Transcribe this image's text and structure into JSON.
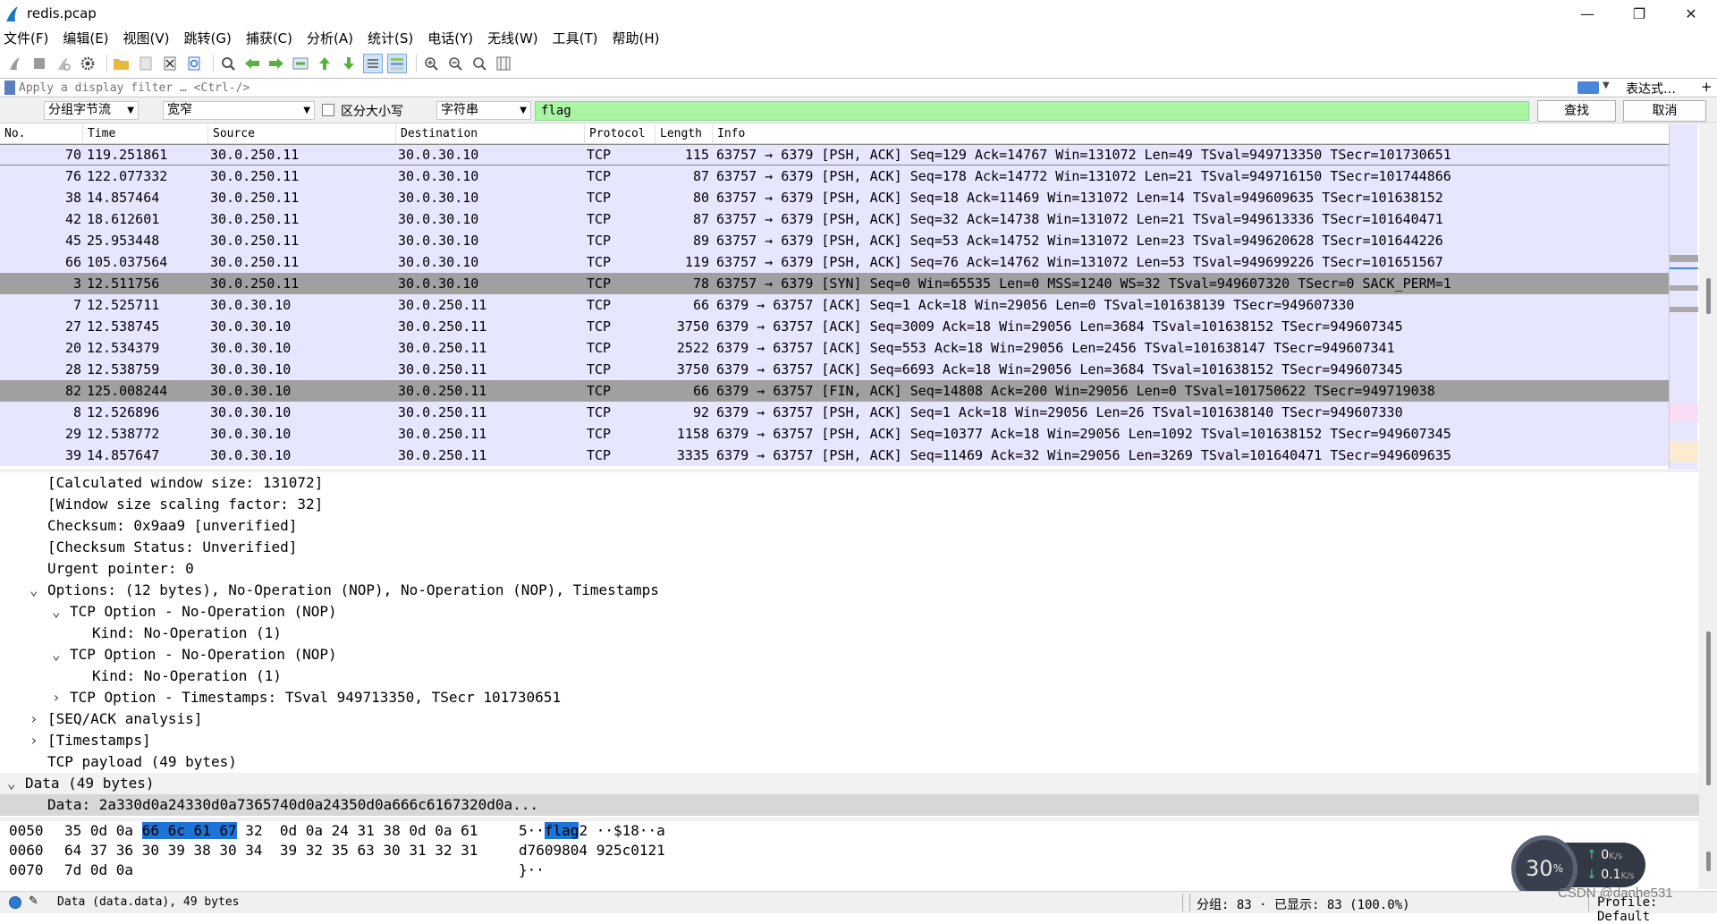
{
  "window": {
    "title": "redis.pcap",
    "minimize": "—",
    "maximize": "❐",
    "close": "✕"
  },
  "menu": [
    "文件(F)",
    "编辑(E)",
    "视图(V)",
    "跳转(G)",
    "捕获(C)",
    "分析(A)",
    "统计(S)",
    "电话(Y)",
    "无线(W)",
    "工具(T)",
    "帮助(H)"
  ],
  "filter": {
    "placeholder": "Apply a display filter … <Ctrl-/>",
    "expression_label": "表达式…",
    "plus": "+"
  },
  "find": {
    "scope": "分组字节流",
    "charset": "宽窄",
    "case_label": "区分大小写",
    "type": "字符串",
    "value": "flag",
    "find_label": "查找",
    "cancel_label": "取消"
  },
  "columns": [
    "No.",
    "Time",
    "Source",
    "Destination",
    "Protocol",
    "Length",
    "Info"
  ],
  "packets": [
    {
      "no": "70",
      "time": "119.251861",
      "src": "30.0.250.11",
      "dst": "30.0.30.10",
      "proto": "TCP",
      "len": "115",
      "info": "63757 → 6379 [PSH, ACK] Seq=129 Ack=14767 Win=131072 Len=49 TSval=949713350 TSecr=101730651",
      "style": "first"
    },
    {
      "no": "76",
      "time": "122.077332",
      "src": "30.0.250.11",
      "dst": "30.0.30.10",
      "proto": "TCP",
      "len": "87",
      "info": "63757 → 6379 [PSH, ACK] Seq=178 Ack=14772 Win=131072 Len=21 TSval=949716150 TSecr=101744866",
      "style": ""
    },
    {
      "no": "38",
      "time": "14.857464",
      "src": "30.0.250.11",
      "dst": "30.0.30.10",
      "proto": "TCP",
      "len": "80",
      "info": "63757 → 6379 [PSH, ACK] Seq=18 Ack=11469 Win=131072 Len=14 TSval=949609635 TSecr=101638152",
      "style": ""
    },
    {
      "no": "42",
      "time": "18.612601",
      "src": "30.0.250.11",
      "dst": "30.0.30.10",
      "proto": "TCP",
      "len": "87",
      "info": "63757 → 6379 [PSH, ACK] Seq=32 Ack=14738 Win=131072 Len=21 TSval=949613336 TSecr=101640471",
      "style": ""
    },
    {
      "no": "45",
      "time": "25.953448",
      "src": "30.0.250.11",
      "dst": "30.0.30.10",
      "proto": "TCP",
      "len": "89",
      "info": "63757 → 6379 [PSH, ACK] Seq=53 Ack=14752 Win=131072 Len=23 TSval=949620628 TSecr=101644226",
      "style": ""
    },
    {
      "no": "66",
      "time": "105.037564",
      "src": "30.0.250.11",
      "dst": "30.0.30.10",
      "proto": "TCP",
      "len": "119",
      "info": "63757 → 6379 [PSH, ACK] Seq=76 Ack=14762 Win=131072 Len=53 TSval=949699226 TSecr=101651567",
      "style": ""
    },
    {
      "no": "3",
      "time": "12.511756",
      "src": "30.0.250.11",
      "dst": "30.0.30.10",
      "proto": "TCP",
      "len": "78",
      "info": "63757 → 6379 [SYN] Seq=0 Win=65535 Len=0 MSS=1240 WS=32 TSval=949607320 TSecr=0 SACK_PERM=1",
      "style": "gray"
    },
    {
      "no": "7",
      "time": "12.525711",
      "src": "30.0.30.10",
      "dst": "30.0.250.11",
      "proto": "TCP",
      "len": "66",
      "info": "6379 → 63757 [ACK] Seq=1 Ack=18 Win=29056 Len=0 TSval=101638139 TSecr=949607330",
      "style": ""
    },
    {
      "no": "27",
      "time": "12.538745",
      "src": "30.0.30.10",
      "dst": "30.0.250.11",
      "proto": "TCP",
      "len": "3750",
      "info": "6379 → 63757 [ACK] Seq=3009 Ack=18 Win=29056 Len=3684 TSval=101638152 TSecr=949607345",
      "style": ""
    },
    {
      "no": "20",
      "time": "12.534379",
      "src": "30.0.30.10",
      "dst": "30.0.250.11",
      "proto": "TCP",
      "len": "2522",
      "info": "6379 → 63757 [ACK] Seq=553 Ack=18 Win=29056 Len=2456 TSval=101638147 TSecr=949607341",
      "style": ""
    },
    {
      "no": "28",
      "time": "12.538759",
      "src": "30.0.30.10",
      "dst": "30.0.250.11",
      "proto": "TCP",
      "len": "3750",
      "info": "6379 → 63757 [ACK] Seq=6693 Ack=18 Win=29056 Len=3684 TSval=101638152 TSecr=949607345",
      "style": ""
    },
    {
      "no": "82",
      "time": "125.008244",
      "src": "30.0.30.10",
      "dst": "30.0.250.11",
      "proto": "TCP",
      "len": "66",
      "info": "6379 → 63757 [FIN, ACK] Seq=14808 Ack=200 Win=29056 Len=0 TSval=101750622 TSecr=949719038",
      "style": "gray"
    },
    {
      "no": "8",
      "time": "12.526896",
      "src": "30.0.30.10",
      "dst": "30.0.250.11",
      "proto": "TCP",
      "len": "92",
      "info": "6379 → 63757 [PSH, ACK] Seq=1 Ack=18 Win=29056 Len=26 TSval=101638140 TSecr=949607330",
      "style": ""
    },
    {
      "no": "29",
      "time": "12.538772",
      "src": "30.0.30.10",
      "dst": "30.0.250.11",
      "proto": "TCP",
      "len": "1158",
      "info": "6379 → 63757 [PSH, ACK] Seq=10377 Ack=18 Win=29056 Len=1092 TSval=101638152 TSecr=949607345",
      "style": ""
    },
    {
      "no": "39",
      "time": "14.857647",
      "src": "30.0.30.10",
      "dst": "30.0.250.11",
      "proto": "TCP",
      "len": "3335",
      "info": "6379 → 63757 [PSH, ACK] Seq=11469 Ack=32 Win=29056 Len=3269 TSval=101640471 TSecr=949609635",
      "style": ""
    }
  ],
  "details": [
    {
      "indent": 2,
      "twisty": "",
      "text": "[Calculated window size: 131072]",
      "style": ""
    },
    {
      "indent": 2,
      "twisty": "",
      "text": "[Window size scaling factor: 32]",
      "style": ""
    },
    {
      "indent": 2,
      "twisty": "",
      "text": "Checksum: 0x9aa9 [unverified]",
      "style": ""
    },
    {
      "indent": 2,
      "twisty": "",
      "text": "[Checksum Status: Unverified]",
      "style": ""
    },
    {
      "indent": 2,
      "twisty": "",
      "text": "Urgent pointer: 0",
      "style": ""
    },
    {
      "indent": 2,
      "twisty": "v",
      "text": "Options: (12 bytes), No-Operation (NOP), No-Operation (NOP), Timestamps",
      "style": ""
    },
    {
      "indent": 3,
      "twisty": "v",
      "text": "TCP Option - No-Operation (NOP)",
      "style": ""
    },
    {
      "indent": 4,
      "twisty": "",
      "text": "Kind: No-Operation (1)",
      "style": ""
    },
    {
      "indent": 3,
      "twisty": "v",
      "text": "TCP Option - No-Operation (NOP)",
      "style": ""
    },
    {
      "indent": 4,
      "twisty": "",
      "text": "Kind: No-Operation (1)",
      "style": ""
    },
    {
      "indent": 3,
      "twisty": ">",
      "text": "TCP Option - Timestamps: TSval 949713350, TSecr 101730651",
      "style": ""
    },
    {
      "indent": 2,
      "twisty": ">",
      "text": "[SEQ/ACK analysis]",
      "style": ""
    },
    {
      "indent": 2,
      "twisty": ">",
      "text": "[Timestamps]",
      "style": ""
    },
    {
      "indent": 2,
      "twisty": "",
      "text": "TCP payload (49 bytes)",
      "style": ""
    },
    {
      "indent": 1,
      "twisty": "v",
      "text": "Data (49 bytes)",
      "style": "hl1"
    },
    {
      "indent": 2,
      "twisty": "",
      "text": "Data: 2a330d0a24330d0a7365740d0a24350d0a666c6167320d0a...",
      "style": "hl2"
    }
  ],
  "hex_rows": [
    {
      "offset": "0050",
      "pre": "35 0d 0a ",
      "sel": "66 6c 61 67",
      "post": " 32  0d 0a 24 31 38 0d 0a 61",
      "apre": "5··",
      "asel": "flag",
      "apost": "2 ··$18··a"
    },
    {
      "offset": "0060",
      "pre": "64 37 36 30 39 38 30 34  39 32 35 63 30 31 32 31",
      "sel": "",
      "post": "",
      "apre": "d7609804 925c0121",
      "asel": "",
      "apost": ""
    },
    {
      "offset": "0070",
      "pre": "7d 0d 0a",
      "sel": "",
      "post": "",
      "apre": "}··",
      "asel": "",
      "apost": ""
    }
  ],
  "status": {
    "message": "Data (data.data), 49 bytes",
    "packets": "分组: 83 · 已显示: 83 (100.0%)",
    "profile": "Profile: Default"
  },
  "net_widget": {
    "percent": "30",
    "percent_unit": "%",
    "up": "0",
    "down": "0.1",
    "unit": "K/s"
  },
  "watermark": "CSDN @danhe531",
  "colors": {
    "row_tcp": "#e7e6ff",
    "row_flag": "#a0a0a0",
    "find_ok": "#a9f5a4",
    "hex_sel": "#1e73d6"
  }
}
